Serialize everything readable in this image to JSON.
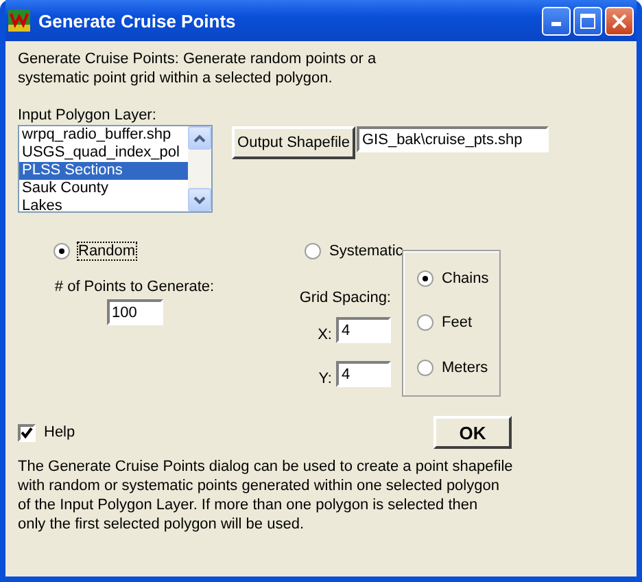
{
  "window": {
    "title": "Generate Cruise Points"
  },
  "intro": "Generate Cruise Points:  Generate random points or a\nsystematic point grid within a selected polygon.",
  "input_layer": {
    "label": "Input Polygon Layer:",
    "items": [
      {
        "label": "wrpq_radio_buffer.shp",
        "selected": false
      },
      {
        "label": "USGS_quad_index_pol",
        "selected": false
      },
      {
        "label": "PLSS Sections",
        "selected": true
      },
      {
        "label": "Sauk County",
        "selected": false
      },
      {
        "label": "Lakes",
        "selected": false
      }
    ]
  },
  "output": {
    "button": "Output Shapefile",
    "value": "GIS_bak\\cruise_pts.shp"
  },
  "mode": [
    {
      "label": "Random",
      "selected": true
    },
    {
      "label": "Systematic",
      "selected": false
    }
  ],
  "points": {
    "label": "# of Points to Generate:",
    "value": "100"
  },
  "grid": {
    "label": "Grid Spacing:",
    "x_label": "X:",
    "x_value": "4",
    "y_label": "Y:",
    "y_value": "4"
  },
  "units": [
    {
      "label": "Chains",
      "selected": true
    },
    {
      "label": "Feet",
      "selected": false
    },
    {
      "label": "Meters",
      "selected": false
    }
  ],
  "help": {
    "label": "Help",
    "checked": true
  },
  "ok_button": "OK",
  "help_text": "The Generate Cruise Points dialog can be used to create a point shapefile\nwith random or systematic points generated within one selected polygon\nof the Input Polygon Layer.  If more than one polygon is selected then\nonly the first selected polygon will be used."
}
